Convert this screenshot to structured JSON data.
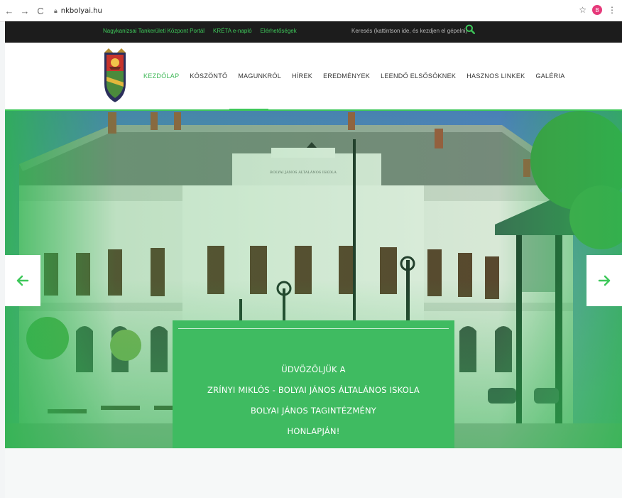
{
  "browser": {
    "url": "nkbolyai.hu",
    "profile_initial": "B"
  },
  "topbar": {
    "links": [
      "Nagykanizsai Tankerületi Központ Portál",
      "KRÉTA e-napló",
      "Elérhetőségek"
    ],
    "search_text": "Keresés (kattintson ide, és kezdjen el gépelni)"
  },
  "menu": {
    "items": [
      "KEZDŐLAP",
      "KÖSZÖNTŐ",
      "MAGUNKRÓL",
      "HÍREK",
      "EREDMÉNYEK",
      "LEENDŐ ELSŐSÖKNEK",
      "HASZNOS LINKEK",
      "GALÉRIA"
    ]
  },
  "hero": {
    "building_sign": "BOLYAI JÁNOS ÁLTALÁNOS ISKOLA",
    "caption_lines": [
      "ÜDVÖZÖLJÜK A",
      "ZRÍNYI MIKLÓS - BOLYAI JÁNOS ÁLTALÁNOS ISKOLA",
      "BOLYAI JÁNOS TAGINTÉZMÉNY",
      "HONLAPJÁN!"
    ]
  },
  "colors": {
    "accent": "#3ec85a",
    "caption_bg": "#3fbb61",
    "topbar_bg": "#1c1c1c"
  }
}
